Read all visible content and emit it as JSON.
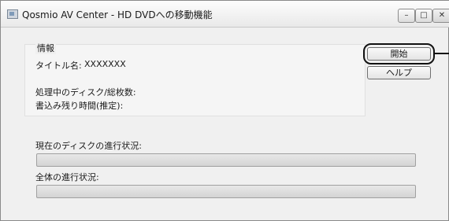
{
  "window": {
    "title": "Qosmio AV Center - HD DVDへの移動機能",
    "controls": {
      "minimize": "–",
      "maximize": "□",
      "close": "✕"
    }
  },
  "info": {
    "group_label": "情報",
    "title_label": "タイトル名:",
    "title_value": "XXXXXXX",
    "disc_progress_label": "処理中のディスク/総枚数:",
    "time_remaining_label": "書込み残り時間(推定):"
  },
  "buttons": {
    "start": "開始",
    "help": "ヘルプ"
  },
  "progress": {
    "current_disc_label": "現在のディスクの進行状況:",
    "current_disc_value": 0,
    "overall_label": "全体の進行状況:",
    "overall_value": 0
  },
  "icons": {
    "app": "app-icon"
  }
}
